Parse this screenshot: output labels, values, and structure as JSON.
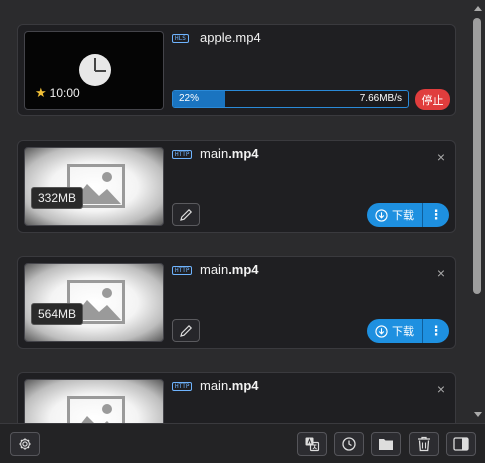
{
  "items": [
    {
      "protocol": "HLS",
      "name_base": "apple",
      "name_ext": ".mp4",
      "duration": "10:00",
      "progress_label": "22%",
      "progress_fraction": 0.22,
      "speed": "7.66MB/s",
      "stop_label": "停止"
    },
    {
      "protocol": "HTTP",
      "name_base": "main",
      "name_ext": ".mp4",
      "size": "332MB",
      "download_label": "下载",
      "more_label": "⋮",
      "close_label": "×"
    },
    {
      "protocol": "HTTP",
      "name_base": "main",
      "name_ext": ".mp4",
      "size": "564MB",
      "download_label": "下载",
      "more_label": "⋮",
      "close_label": "×"
    },
    {
      "protocol": "HTTP",
      "name_base": "main",
      "name_ext": ".mp4",
      "close_label": "×"
    }
  ],
  "icons": {
    "duration": "star-icon",
    "settings": "gear-icon",
    "translate": "translate-icon",
    "history": "clock-icon",
    "folder": "folder-icon",
    "delete": "trash-icon",
    "panel": "sidebar-panel-icon",
    "edit": "pencil-icon",
    "download": "download-circle-icon"
  },
  "colors": {
    "accent": "#1e90e0",
    "stop": "#e03d3d",
    "star": "#f2c037",
    "progress": "#1a74c0"
  }
}
